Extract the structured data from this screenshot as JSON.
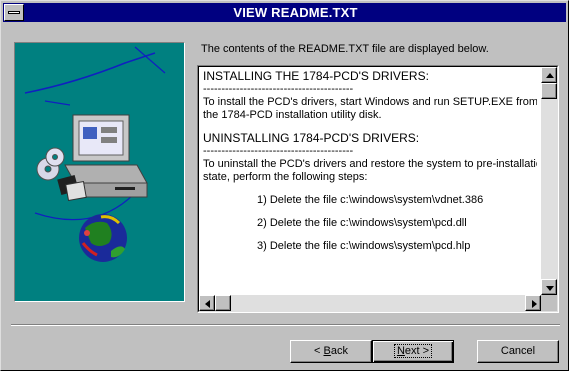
{
  "window": {
    "title": "VIEW README.TXT"
  },
  "intro_text": "The contents of the README.TXT file are displayed below.",
  "readme": {
    "lines": [
      {
        "text": "INSTALLING THE 1784-PCD'S DRIVERS:",
        "style": "heading"
      },
      {
        "text": "-----------------------------------------",
        "style": "plain"
      },
      {
        "text": "To install the PCD's drivers, start Windows and run SETUP.EXE from",
        "style": "plain"
      },
      {
        "text": "the 1784-PCD installation utility disk.",
        "style": "plain"
      },
      {
        "text": "UNINSTALLING 1784-PCD'S DRIVERS:",
        "style": "heading"
      },
      {
        "text": "-----------------------------------------",
        "style": "plain"
      },
      {
        "text": "To uninstall the PCD's drivers and restore the system to pre-installation",
        "style": "plain"
      },
      {
        "text": "state, perform the following steps:",
        "style": "plain"
      },
      {
        "text": "1) Delete the file c:\\windows\\system\\vdnet.386",
        "style": "indent"
      },
      {
        "text": "2) Delete the file c:\\windows\\system\\pcd.dll",
        "style": "indent"
      },
      {
        "text": "3) Delete the file c:\\windows\\system\\pcd.hlp",
        "style": "indent"
      }
    ]
  },
  "buttons": {
    "back": {
      "prefix": "< ",
      "hotkey": "B",
      "rest": "ack"
    },
    "next": {
      "hotkey": "N",
      "rest": "ext >"
    },
    "cancel": "Cancel"
  },
  "colors": {
    "titlebar": "#000080",
    "graphic_background": "#008080",
    "dialog_face": "#c0c0c0"
  },
  "icons": {
    "graphic": "computer-with-globe-and-discs",
    "scroll_up": "arrow-up",
    "scroll_down": "arrow-down",
    "scroll_left": "arrow-left",
    "scroll_right": "arrow-right"
  }
}
